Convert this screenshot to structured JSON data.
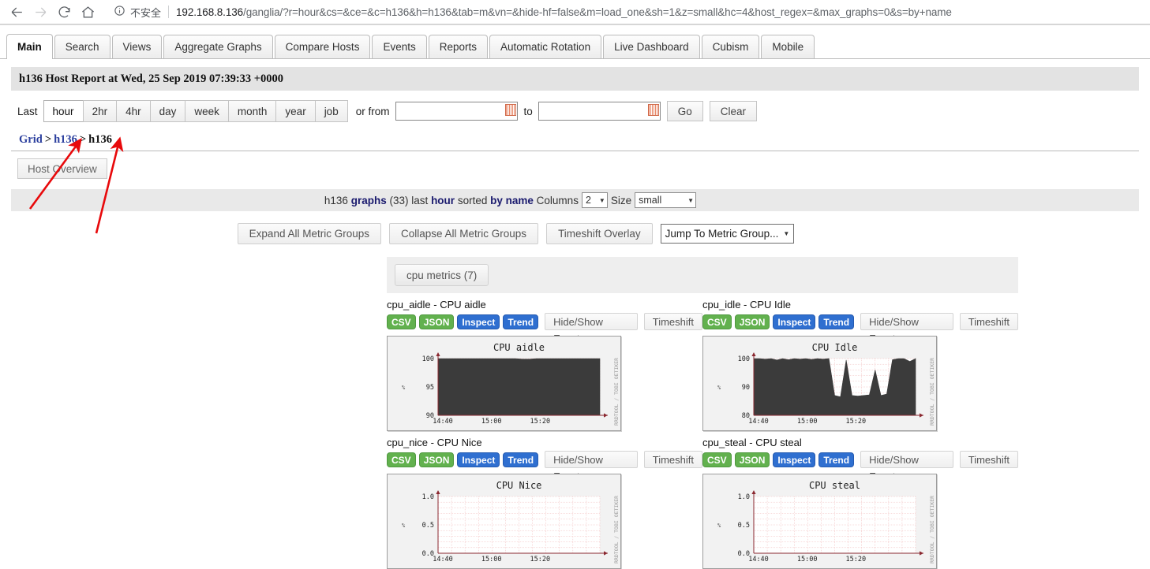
{
  "browser": {
    "back_icon": "back-arrow-icon",
    "forward_icon": "forward-arrow-icon",
    "reload_icon": "reload-icon",
    "home_icon": "home-icon",
    "security_icon": "info-circle-icon",
    "security_text": "不安全",
    "url_host": "192.168.8.136",
    "url_path": "/ganglia/?r=hour&cs=&ce=&c=h136&h=h136&tab=m&vn=&hide-hf=false&m=load_one&sh=1&z=small&hc=4&host_regex=&max_graphs=0&s=by+name"
  },
  "tabs": [
    {
      "label": "Main",
      "active": true
    },
    {
      "label": "Search",
      "active": false
    },
    {
      "label": "Views",
      "active": false
    },
    {
      "label": "Aggregate Graphs",
      "active": false
    },
    {
      "label": "Compare Hosts",
      "active": false
    },
    {
      "label": "Events",
      "active": false
    },
    {
      "label": "Reports",
      "active": false
    },
    {
      "label": "Automatic Rotation",
      "active": false
    },
    {
      "label": "Live Dashboard",
      "active": false
    },
    {
      "label": "Cubism",
      "active": false
    },
    {
      "label": "Mobile",
      "active": false
    }
  ],
  "header": {
    "title": "h136 Host Report at Wed, 25 Sep 2019 07:39:33 +0000"
  },
  "range": {
    "last_label": "Last",
    "buttons": [
      {
        "label": "hour",
        "active": true
      },
      {
        "label": "2hr",
        "active": false
      },
      {
        "label": "4hr",
        "active": false
      },
      {
        "label": "day",
        "active": false
      },
      {
        "label": "week",
        "active": false
      },
      {
        "label": "month",
        "active": false
      },
      {
        "label": "year",
        "active": false
      },
      {
        "label": "job",
        "active": false
      }
    ],
    "or_from_label": "or from",
    "from_value": "",
    "to_label": "to",
    "to_value": "",
    "go_label": "Go",
    "clear_label": "Clear",
    "calendar_icon": "calendar-icon"
  },
  "breadcrumb": {
    "grid": "Grid",
    "sep": ">",
    "cluster": "h136",
    "host": "h136"
  },
  "host_overview_label": "Host Overview",
  "graphbar": {
    "host": "h136",
    "graphs_word": "graphs",
    "count": "(33)",
    "last_word": "last",
    "period": "hour",
    "sorted_word": "sorted",
    "sort_by": "by name",
    "columns_label": "Columns",
    "columns_value": "2",
    "size_label": "Size",
    "size_value": "small"
  },
  "controls": {
    "expand_label": "Expand All Metric Groups",
    "collapse_label": "Collapse All Metric Groups",
    "timeshift_overlay_label": "Timeshift Overlay",
    "jump_label": "Jump To Metric Group..."
  },
  "metric_group": {
    "label": "cpu metrics (7)"
  },
  "actions": {
    "csv": "CSV",
    "json": "JSON",
    "inspect": "Inspect",
    "trend": "Trend",
    "hide_show_events": "Hide/Show Events",
    "timeshift": "Timeshift"
  },
  "graphs": [
    {
      "metric_label": "cpu_aidle - CPU aidle",
      "chart_data": {
        "type": "area",
        "title": "CPU aidle",
        "ylabel": "%",
        "xlabel": "",
        "ylim": [
          90,
          100
        ],
        "yticks": [
          "90",
          "95",
          "100"
        ],
        "xticks": [
          "14:40",
          "15:00",
          "15:20"
        ],
        "watermark": "RRDTOOL / TOBI OETIKER",
        "grid": true,
        "series": [
          {
            "name": "CPU aidle",
            "color": "#3b3b3b",
            "values": [
              100,
              100,
              100,
              100,
              100,
              100,
              100,
              100,
              100,
              100,
              100,
              100,
              99.9,
              99.9,
              100,
              100,
              100,
              100,
              100,
              100,
              100,
              100,
              100,
              100
            ]
          }
        ]
      }
    },
    {
      "metric_label": "cpu_idle - CPU Idle",
      "chart_data": {
        "type": "area",
        "title": "CPU Idle",
        "ylabel": "%",
        "xlabel": "",
        "ylim": [
          80,
          100
        ],
        "yticks": [
          "80",
          "90",
          "100"
        ],
        "xticks": [
          "14:40",
          "15:00",
          "15:20"
        ],
        "watermark": "RRDTOOL / TOBI OETIKER",
        "grid": true,
        "series": [
          {
            "name": "CPU Idle",
            "color": "#3b3b3b",
            "values": [
              100,
              100,
              99.8,
              100,
              99.5,
              100,
              99.6,
              100,
              99.8,
              100,
              99.7,
              100,
              99.8,
              100,
              87,
              86.5,
              99.5,
              87,
              86.8,
              87,
              87.2,
              96,
              87,
              87.5,
              99.6,
              100,
              100,
              99,
              100
            ]
          }
        ]
      }
    },
    {
      "metric_label": "cpu_nice - CPU Nice",
      "chart_data": {
        "type": "area",
        "title": "CPU Nice",
        "ylabel": "%",
        "xlabel": "",
        "ylim": [
          0,
          1
        ],
        "yticks": [
          "0.0",
          "0.5",
          "1.0"
        ],
        "xticks": [
          "14:40",
          "15:00",
          "15:20"
        ],
        "watermark": "RRDTOOL / TOBI OETIKER",
        "grid": true,
        "series": [
          {
            "name": "CPU Nice",
            "color": "#3b3b3b",
            "values": [
              0,
              0,
              0,
              0,
              0,
              0,
              0,
              0,
              0,
              0,
              0,
              0,
              0,
              0,
              0,
              0,
              0,
              0,
              0,
              0,
              0,
              0,
              0,
              0
            ]
          }
        ]
      }
    },
    {
      "metric_label": "cpu_steal - CPU steal",
      "chart_data": {
        "type": "area",
        "title": "CPU steal",
        "ylabel": "%",
        "xlabel": "",
        "ylim": [
          0,
          1
        ],
        "yticks": [
          "0.0",
          "0.5",
          "1.0"
        ],
        "xticks": [
          "14:40",
          "15:00",
          "15:20"
        ],
        "watermark": "RRDTOOL / TOBI OETIKER",
        "grid": true,
        "series": [
          {
            "name": "CPU steal",
            "color": "#3b3b3b",
            "values": [
              0,
              0,
              0,
              0,
              0,
              0,
              0,
              0,
              0,
              0,
              0,
              0,
              0,
              0,
              0,
              0,
              0,
              0,
              0,
              0,
              0,
              0,
              0,
              0
            ]
          }
        ]
      }
    }
  ],
  "annotations": {
    "arrow_color": "#e8090b",
    "arrows": [
      {
        "name": "arrow-to-cluster-link"
      },
      {
        "name": "arrow-to-host-link"
      }
    ]
  }
}
